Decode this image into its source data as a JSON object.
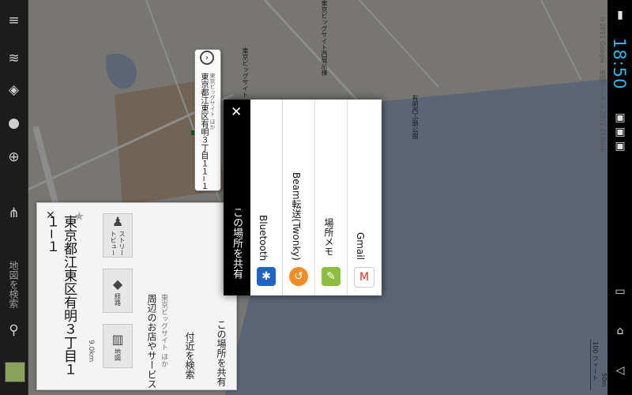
{
  "status_bar": {
    "clock": "18:50",
    "icons": [
      "signal-icon",
      "wifi-icon",
      "battery-icon",
      "usb-icon",
      "notification-icon",
      "download-icon"
    ]
  },
  "system_nav": {
    "buttons": [
      "back-icon",
      "home-icon",
      "recent-apps-icon"
    ]
  },
  "toolbar": {
    "search_hint": "地図を検索",
    "items": [
      "menu-icon",
      "layers-icon",
      "directions-icon",
      "places-icon",
      "my-location-icon",
      "mic-icon",
      "search-icon"
    ]
  },
  "map": {
    "copyright": "©2011 Google - 地図データ ©2011 ZENRIN",
    "labels": [
      "有明西ふ頭公園",
      "東京ビッグサイト西展示棟",
      "東京ビッグサイト"
    ],
    "scale_ft": "100 フィート",
    "scale_m": "50m",
    "colors": {
      "land": "#d9d8d2",
      "water": "#a7b8d6",
      "block": "#c9a98a",
      "road": "#ffffff"
    }
  },
  "pin_bubble": {
    "title": "東京都江東区有明３丁目１１−１",
    "subtitle": "東京ビッグサイト ほか"
  },
  "place_card": {
    "title": "東京都江東区有明３丁目１１−１",
    "distance": "9.0km",
    "buttons": [
      {
        "label": "地図",
        "icon": "map-icon"
      },
      {
        "label": "経路",
        "icon": "route-icon"
      },
      {
        "label": "ストリートビュー",
        "icon": "street-view-icon"
      }
    ],
    "rows": [
      {
        "label": "周辺のお店やサービス",
        "sub": "東京ビッグサイト ほか"
      },
      {
        "label": "付近を検索",
        "sub": ""
      },
      {
        "label": "この場所を共有",
        "sub": ""
      }
    ]
  },
  "share_dialog": {
    "title": "この場所を共有",
    "options": [
      {
        "label": "Bluetooth",
        "icon": "bluetooth-icon",
        "color": "#1e63c6"
      },
      {
        "label": "Beam転送(Twonky)",
        "icon": "beam-icon",
        "color": "#f28c28"
      },
      {
        "label": "場所メモ",
        "icon": "place-memo-icon",
        "color": "#8cbf3f"
      },
      {
        "label": "Gmail",
        "icon": "gmail-icon",
        "color": "#d93025"
      }
    ]
  }
}
